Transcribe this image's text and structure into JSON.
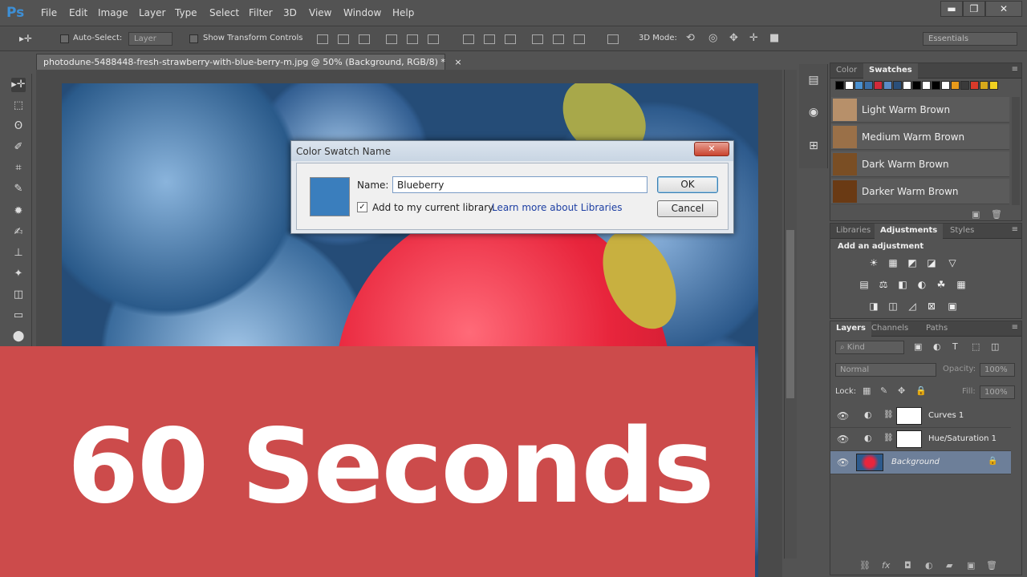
{
  "app": {
    "logo": "Ps",
    "menu": [
      "File",
      "Edit",
      "Image",
      "Layer",
      "Type",
      "Select",
      "Filter",
      "3D",
      "View",
      "Window",
      "Help"
    ],
    "window_controls": {
      "minimize": "▬",
      "restore": "❐",
      "close": "✕"
    }
  },
  "options_bar": {
    "tool_glyph": "▸✛",
    "auto_select_label": "Auto-Select:",
    "auto_select_target": "Layer",
    "show_transform_label": "Show Transform Controls",
    "mode_3d_label": "3D Mode:",
    "workspace": "Essentials"
  },
  "tools": [
    "▸✛",
    "⬚",
    "ʘ",
    "✐",
    "⌗",
    "✎",
    "✹",
    "✍",
    "⊥",
    "✦",
    "◫",
    "▭",
    "⬤"
  ],
  "document": {
    "tab_title": "photodune-5488448-fresh-strawberry-with-blue-berry-m.jpg @ 50% (Background, RGB/8) *",
    "tab_close": "×"
  },
  "dialog": {
    "title": "Color Swatch Name",
    "close_glyph": "✕",
    "name_label": "Name:",
    "name_value": "Blueberry",
    "swatch_color": "#3a7ebd",
    "add_to_library_label": "Add to my current library.",
    "add_to_library_checked": "✓",
    "learn_more_link": "Learn more about Libraries",
    "ok_label": "OK",
    "cancel_label": "Cancel"
  },
  "banner": {
    "text": "60 Seconds",
    "color": "#cc4b4b"
  },
  "swatches_panel": {
    "tabs": [
      "Color",
      "Swatches"
    ],
    "active_tab": "Swatches",
    "swatch_row": [
      "#000000",
      "#ffffff",
      "#4a90d0",
      "#3b6fa8",
      "#d22a3a",
      "#5a8cc8",
      "#2a4f7a",
      "#ffffff",
      "#000000",
      "#ffffff",
      "#000000",
      "#ffffff",
      "#e89a1a",
      "#3a3a3a",
      "#d93a2a",
      "#d6a81a",
      "#f0d020"
    ],
    "items": [
      {
        "name": "Light Warm Brown",
        "color": "#b7906a"
      },
      {
        "name": "Medium Warm Brown",
        "color": "#9a7048"
      },
      {
        "name": "Dark Warm Brown",
        "color": "#7a4e24"
      },
      {
        "name": "Darker Warm Brown",
        "color": "#6a3a14"
      }
    ]
  },
  "adjustments_panel": {
    "tabs": [
      "Libraries",
      "Adjustments",
      "Styles"
    ],
    "active_tab": "Adjustments",
    "heading": "Add an adjustment",
    "icons_row1": [
      "☀",
      "▦",
      "◩",
      "◪",
      "▽"
    ],
    "icons_row2": [
      "▤",
      "⚖",
      "◧",
      "◐",
      "☘",
      "▦"
    ],
    "icons_row3": [
      "◨",
      "◫",
      "◿",
      "⊠",
      "▣"
    ]
  },
  "layers_panel": {
    "tabs": [
      "Layers",
      "Channels",
      "Paths"
    ],
    "active_tab": "Layers",
    "filter_label": "Kind",
    "blend_mode": "Normal",
    "opacity_label": "Opacity:",
    "opacity_value": "100%",
    "lock_label": "Lock:",
    "fill_label": "Fill:",
    "fill_value": "100%",
    "layers": [
      {
        "name": "Curves 1"
      },
      {
        "name": "Hue/Saturation 1"
      },
      {
        "name": "Background"
      }
    ]
  },
  "panel_menu_glyph": "≡",
  "eye_glyph": "👁",
  "lock_glyph": "🔒",
  "link_glyph": "⛓"
}
